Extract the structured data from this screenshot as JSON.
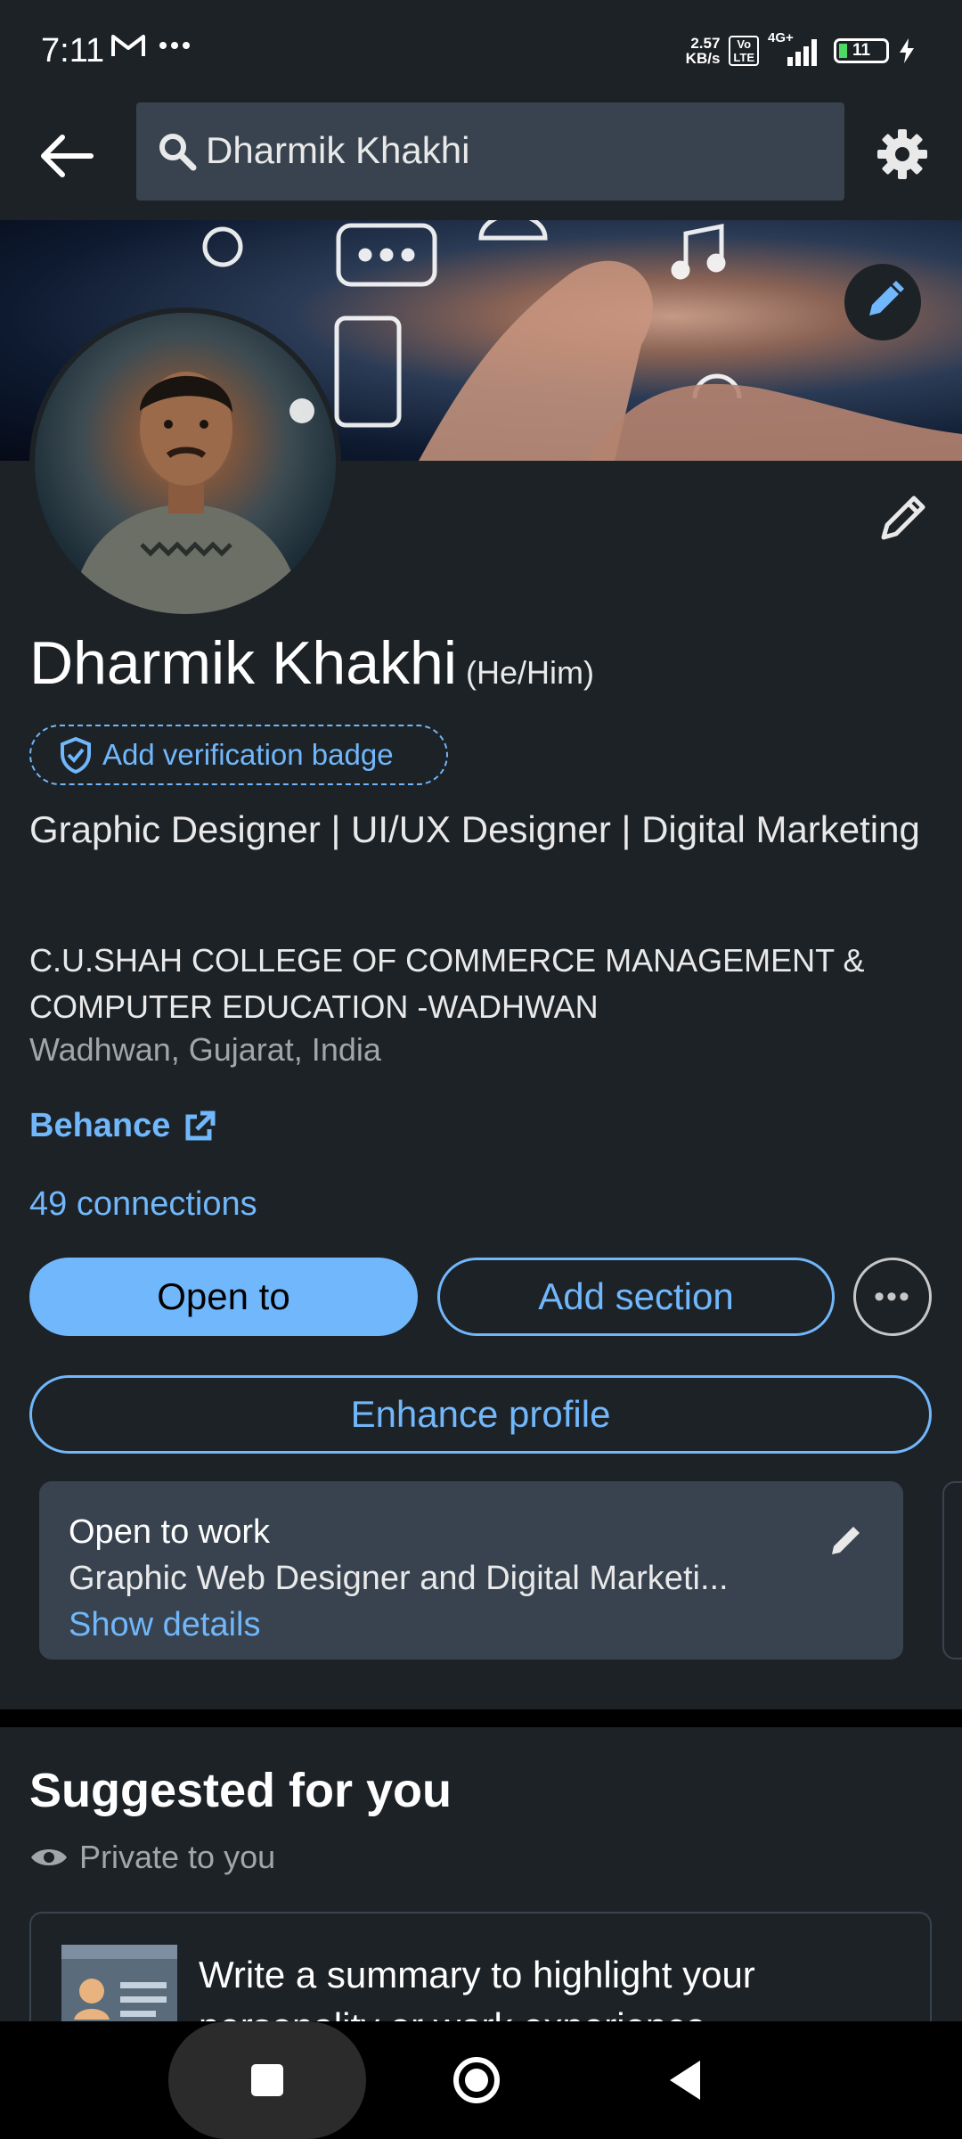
{
  "status": {
    "time": "7:11",
    "net_speed_value": "2.57",
    "net_speed_unit": "KB/s",
    "volte_top": "Vo",
    "volte_bottom": "LTE",
    "network": "4G+",
    "battery": "11"
  },
  "search": {
    "query": "Dharmik Khakhi"
  },
  "profile": {
    "name": "Dharmik Khakhi",
    "pronouns": "(He/Him)",
    "verification_label": "Add verification badge",
    "headline": "Graphic Designer | UI/UX Designer | Digital Marketing",
    "education": "C.U.SHAH COLLEGE OF COMMERCE MANAGEMENT & COMPUTER EDUCATION -WADHWAN",
    "location": "Wadhwan, Gujarat, India",
    "website_label": "Behance",
    "connections": "49 connections"
  },
  "actions": {
    "open_to": "Open to",
    "add_section": "Add section",
    "more": "•••",
    "enhance_profile": "Enhance profile"
  },
  "open_to_work": {
    "title": "Open to work",
    "description": "Graphic Web Designer and Digital Marketi...",
    "link": "Show details"
  },
  "suggested": {
    "title": "Suggested for you",
    "visibility": "Private to you",
    "card_text": "Write a summary to highlight your personality or work experience"
  },
  "colors": {
    "background": "#1d2226",
    "accent": "#71b7fb",
    "card": "#38434f"
  }
}
